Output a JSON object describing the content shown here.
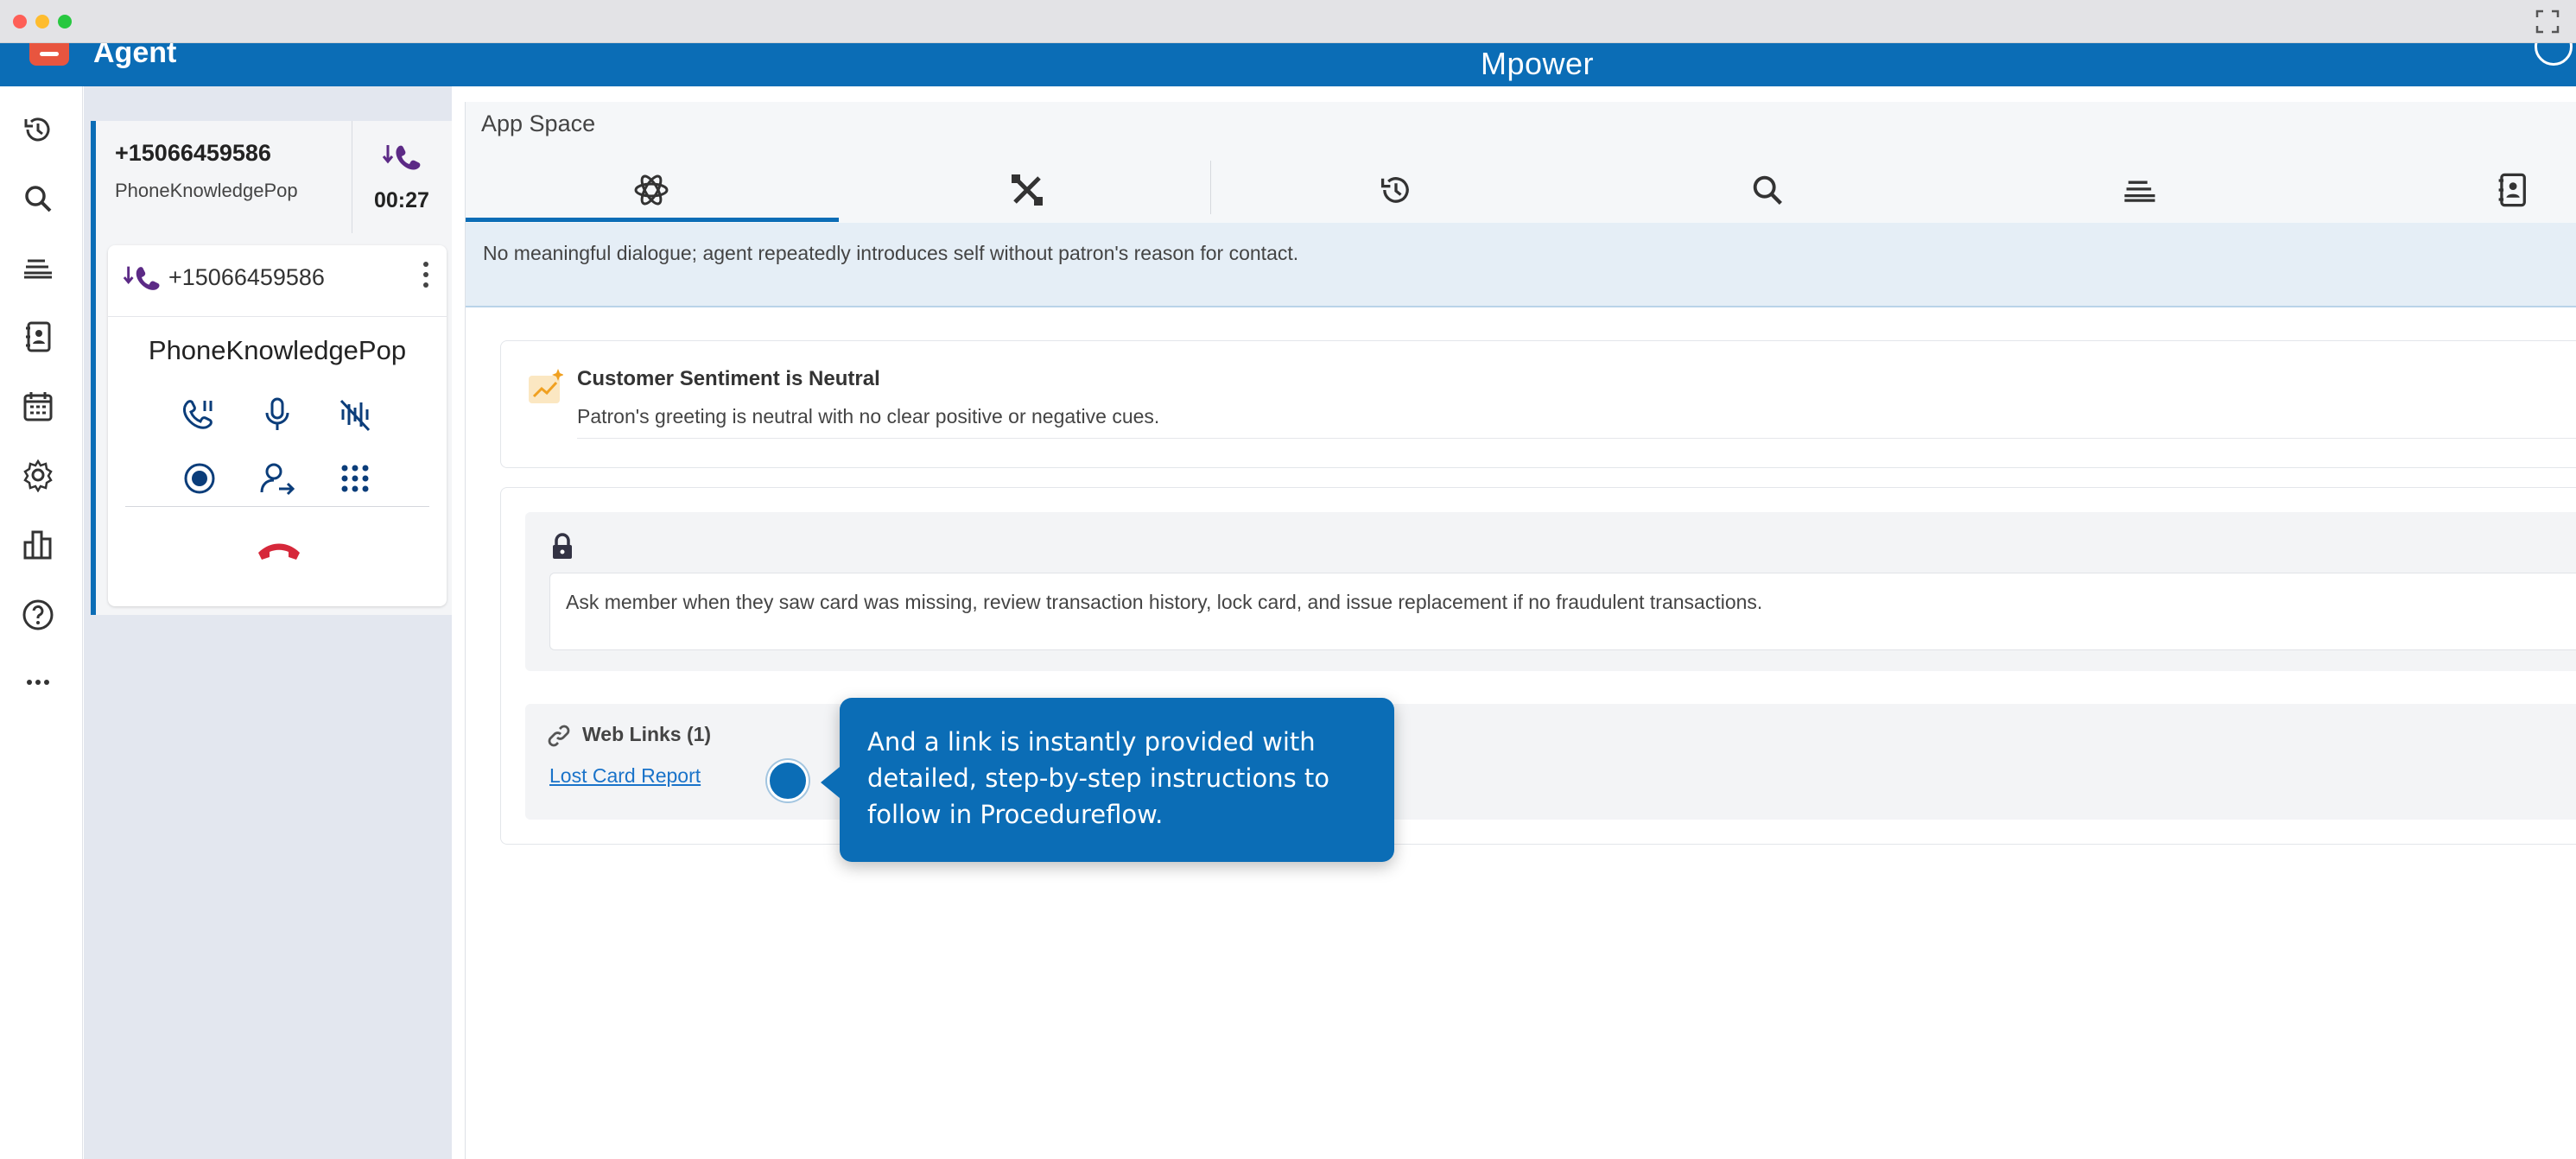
{
  "app": {
    "title": "Agent",
    "brand": "Mpower"
  },
  "rail": {
    "items": [
      "history-icon",
      "search-icon",
      "queue-icon",
      "contacts-icon",
      "calendar-icon",
      "settings-icon",
      "reports-icon",
      "help-icon",
      "more-icon"
    ]
  },
  "conversation": {
    "number": "+15066459586",
    "queue": "PhoneKnowledgePop",
    "timer": "00:27",
    "call": {
      "number": "+15066459586",
      "name": "PhoneKnowledgePop"
    }
  },
  "appspace": {
    "title": "App Space",
    "tabs": [
      "ai-assist-icon",
      "tools-icon",
      "history-icon",
      "search-icon",
      "queue-icon",
      "contacts-icon"
    ],
    "summary": "No meaningful dialogue; agent repeatedly introduces self without patron's reason for contact.",
    "sentiment": {
      "title": "Customer Sentiment is Neutral",
      "description": "Patron's greeting is neutral with no clear positive or negative cues."
    },
    "guidance": {
      "text": "Ask member when they saw card was missing, review transaction history, lock card, and issue replacement if no fraudulent transactions."
    },
    "web_links": {
      "title": "Web Links (1)",
      "items": [
        "Lost Card Report"
      ]
    }
  },
  "tooltip": {
    "text": "And a link is instantly provided with detailed, step-by-step instructions to follow in Procedureflow."
  },
  "colors": {
    "primary": "#0b6db6",
    "call_purple": "#5c2a86",
    "hangup_red": "#d6283a",
    "sentiment_orange": "#f0a020"
  }
}
